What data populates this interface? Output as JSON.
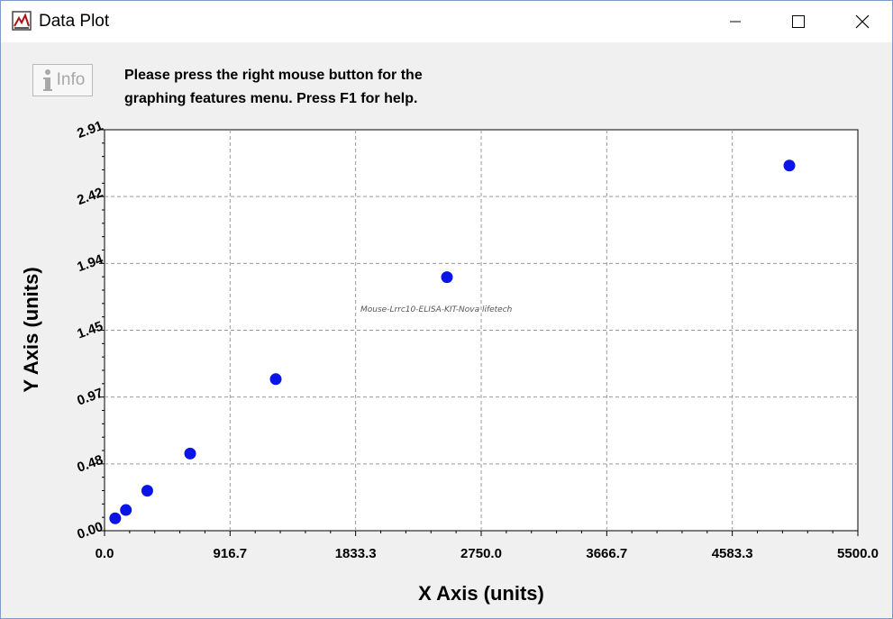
{
  "window": {
    "title": "Data Plot",
    "controls": {
      "minimize": "minimize",
      "maximize": "maximize",
      "close": "close"
    }
  },
  "toolbar": {
    "info_label": "Info"
  },
  "instructions": {
    "line1": "Please press the right mouse button for the",
    "line2": "graphing features menu.  Press F1 for help."
  },
  "chart_data": {
    "type": "scatter",
    "title": "",
    "xlabel": "X Axis (units)",
    "ylabel": "Y Axis (units)",
    "xlim": [
      0,
      5500
    ],
    "ylim": [
      0,
      2.91
    ],
    "x_ticks": [
      "0.0",
      "916.7",
      "1833.3",
      "2750.0",
      "3666.7",
      "4583.3",
      "5500.0"
    ],
    "y_ticks": [
      "0.00",
      "0.48",
      "0.97",
      "1.45",
      "1.94",
      "2.42",
      "2.91"
    ],
    "grid": true,
    "annotation": "Mouse-Lrrc10-ELISA-KIT-Nova lifetech",
    "marker_color": "#0a14e6",
    "series": [
      {
        "points": [
          {
            "x": 78,
            "y": 0.09
          },
          {
            "x": 156,
            "y": 0.15
          },
          {
            "x": 312,
            "y": 0.29
          },
          {
            "x": 625,
            "y": 0.56
          },
          {
            "x": 1250,
            "y": 1.1
          },
          {
            "x": 2500,
            "y": 1.84
          },
          {
            "x": 5000,
            "y": 2.65
          }
        ]
      }
    ]
  }
}
